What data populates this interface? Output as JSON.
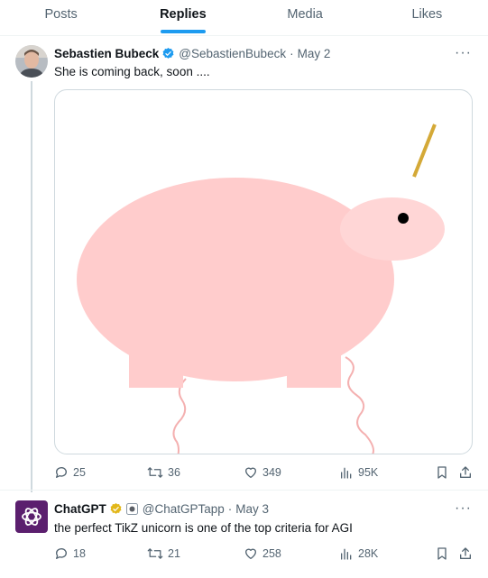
{
  "tabs": [
    {
      "label": "Posts"
    },
    {
      "label": "Replies"
    },
    {
      "label": "Media"
    },
    {
      "label": "Likes"
    }
  ],
  "tweets": [
    {
      "name": "Sebastien Bubeck",
      "handle": "@SebastienBubeck",
      "separator": "·",
      "date": "May 2",
      "text": "She is coming back, soon ....",
      "replies": "25",
      "reposts": "36",
      "likes": "349",
      "views": "95K",
      "verified_color": "#1d9bf0"
    },
    {
      "name": "ChatGPT",
      "handle": "@ChatGPTapp",
      "separator": "·",
      "date": "May 3",
      "text": "the perfect TikZ unicorn is one of the top criteria for AGI",
      "replies": "18",
      "reposts": "21",
      "likes": "258",
      "views": "28K",
      "verified_color": "#e2b719"
    }
  ],
  "icons": {
    "more": "more-icon",
    "reply": "reply-icon",
    "repost": "repost-icon",
    "like": "like-icon",
    "views": "views-icon",
    "bookmark": "bookmark-icon",
    "share": "share-icon"
  },
  "colors": {
    "accent": "#1d9bf0",
    "unicorn_body": "#ffcccc",
    "unicorn_head": "#ffd6d6",
    "horn": "#d4a937",
    "legs": "#f4b0b0"
  }
}
